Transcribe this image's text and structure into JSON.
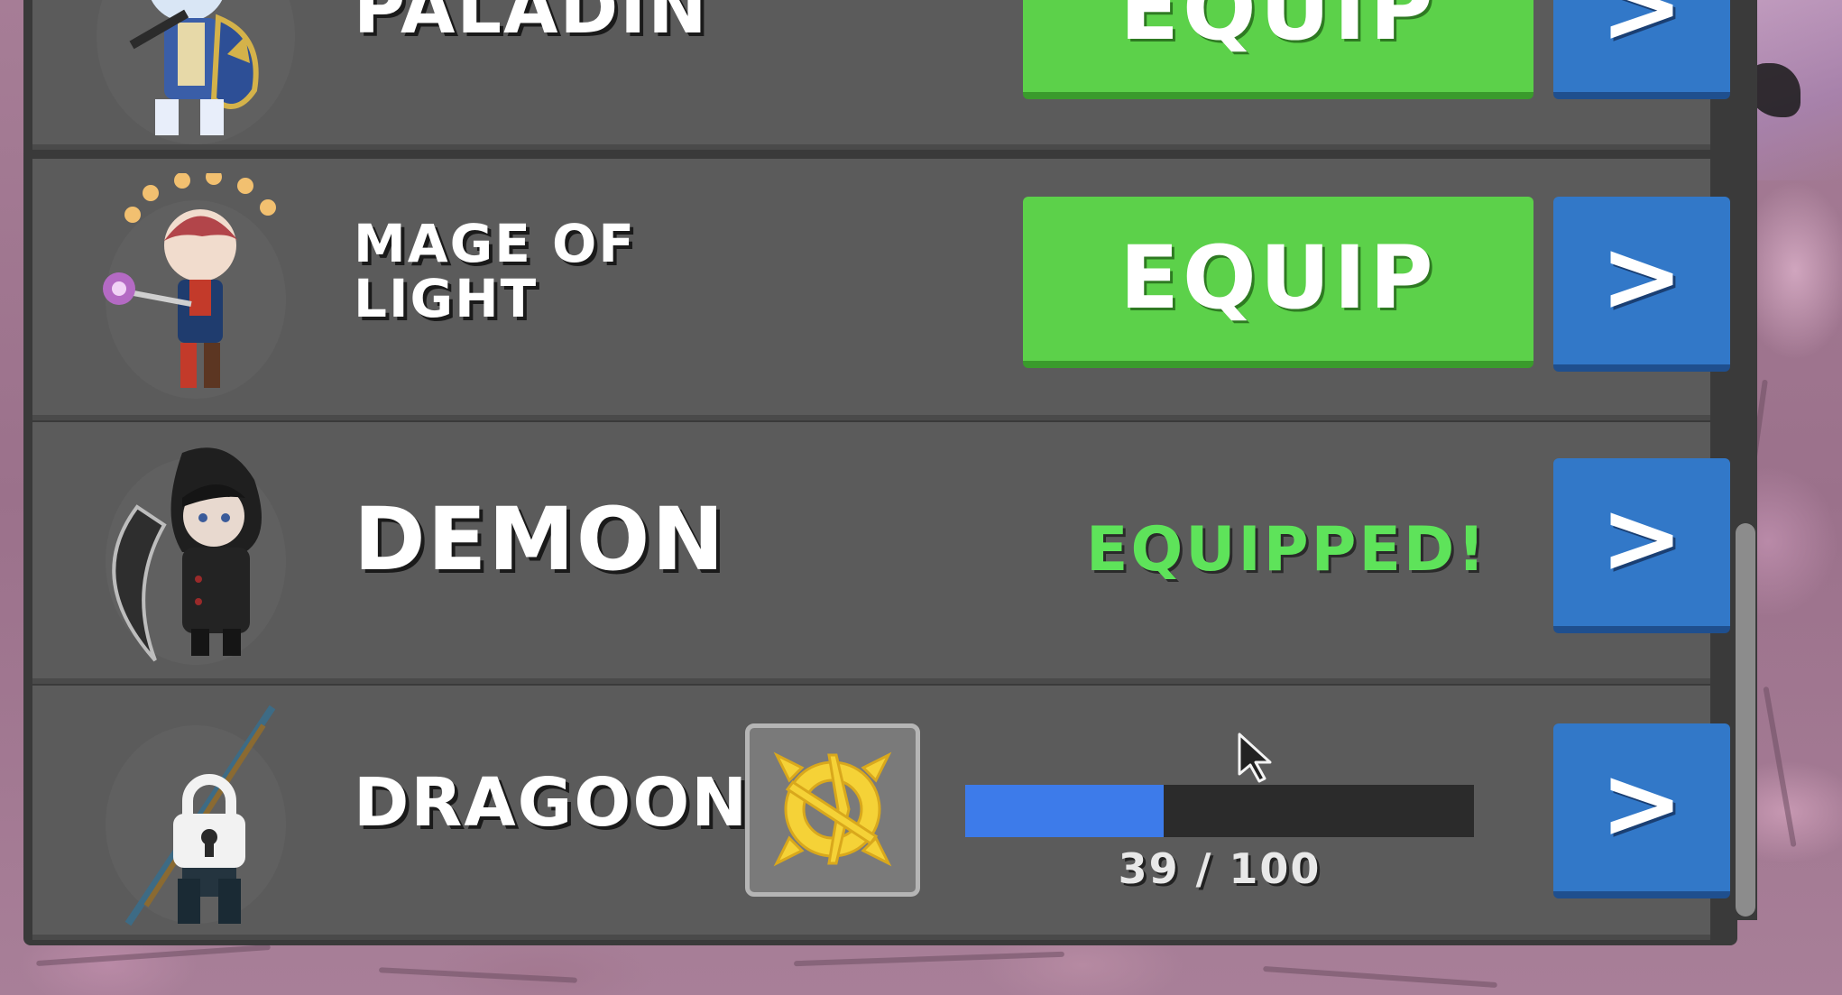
{
  "colors": {
    "panel_bg": "#3a3a3a",
    "row_bg": "#5b5b5b",
    "equip_green": "#5cd14a",
    "equipped_text": "#5ee35a",
    "arrow_blue": "#3278c8",
    "progress_blue": "#3d7bea"
  },
  "classes": [
    {
      "name": "PALADIN",
      "action_label": "EQUIP",
      "arrow_label": ">",
      "state": "available",
      "portrait_icon": "paladin-portrait-icon"
    },
    {
      "name_line1": "MAGE OF",
      "name_line2": "LIGHT",
      "action_label": "EQUIP",
      "arrow_label": ">",
      "state": "available",
      "portrait_icon": "mage-portrait-icon"
    },
    {
      "name": "DEMON",
      "status_label": "EQUIPPED!",
      "arrow_label": ">",
      "state": "equipped",
      "portrait_icon": "demon-portrait-icon"
    },
    {
      "name": "DRAGOON",
      "arrow_label": ">",
      "state": "locked",
      "portrait_icon": "dragoon-portrait-icon",
      "lock_icon": "padlock-icon",
      "requirement_icon": "gold-emblem-icon",
      "progress": {
        "current": 39,
        "max": 100,
        "text": "39 / 100"
      }
    }
  ]
}
